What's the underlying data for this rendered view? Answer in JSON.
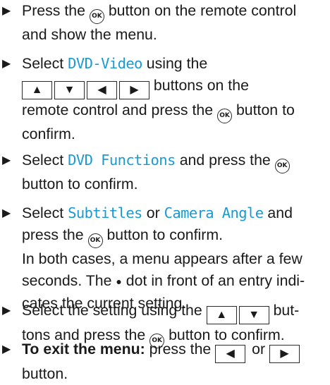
{
  "icons": {
    "bullet": "▶",
    "ok": "OK",
    "up": "▲",
    "down": "▼",
    "left": "◀",
    "right": "▶",
    "dot": "●"
  },
  "steps": [
    {
      "lines": [
        "Press the",
        "button on the remote control",
        "and show the menu."
      ]
    },
    {
      "select": "Select",
      "keyword": "DVD-Video",
      "using": "using the",
      "buttons_on": "buttons on the",
      "remote_text": "remote control and press the",
      "button_to": "button to",
      "confirm": "confirm."
    },
    {
      "select": "Select",
      "keyword": "DVD Functions",
      "and_press": "and press the",
      "button_confirm": "button to confirm."
    },
    {
      "select": "Select",
      "keyword1": "Subtitles",
      "or": "or",
      "keyword2": "Camera Angle",
      "and": "and",
      "press_the": "press the",
      "button_confirm": "button to confirm.",
      "note1": "In both cases, a menu appears after a few",
      "note2a": "seconds. The",
      "note2b": "dot in front of an entry indi-",
      "note3": "cates the current setting."
    },
    {
      "select_setting": "Select the setting using the",
      "but": "but-",
      "tons_press": "tons and press the",
      "button_confirm": "button to confirm."
    },
    {
      "bold": "To exit the menu:",
      "press_the": "press the",
      "or": "or",
      "button": "button."
    }
  ]
}
